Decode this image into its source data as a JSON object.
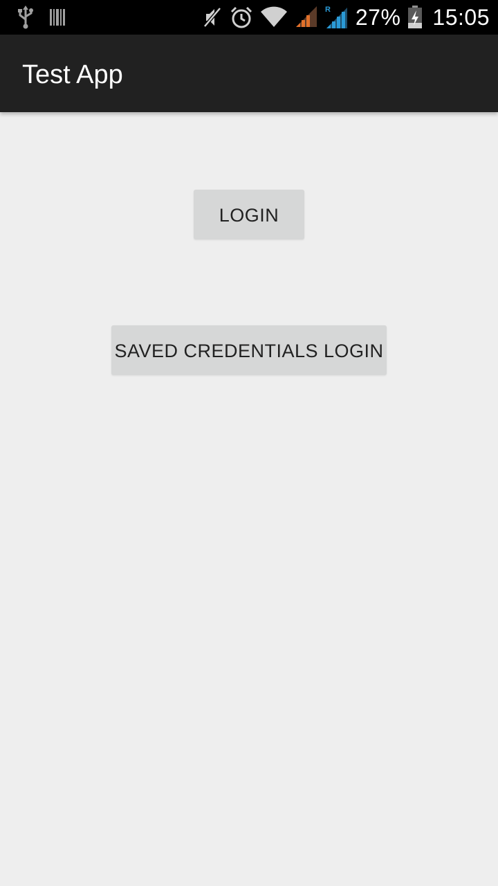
{
  "status_bar": {
    "left_icons": [
      "usb-icon",
      "barcode-icon"
    ],
    "right_icons": [
      "mute-icon",
      "alarm-icon",
      "wifi-icon",
      "signal-sim1-icon",
      "signal-sim2-roaming-icon",
      "battery-charging-icon"
    ],
    "roaming_indicator": "R",
    "battery_percent": "27%",
    "battery_level": 0.27,
    "time": "15:05",
    "colors": {
      "sim1_signal": "#e0702a",
      "sim2_signal": "#2a9ad6"
    }
  },
  "action_bar": {
    "title": "Test App",
    "background": "#212121"
  },
  "main": {
    "background": "#eeeeee",
    "buttons": {
      "login": "LOGIN",
      "saved_credentials_login": "SAVED CREDENTIALS LOGIN"
    }
  }
}
